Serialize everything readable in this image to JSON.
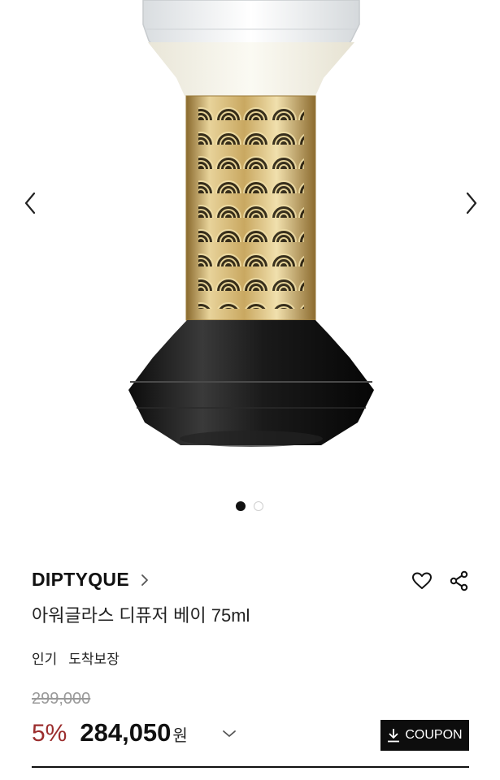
{
  "gallery": {
    "slide_count": 2,
    "active_slide": 1,
    "prev_icon": "chevron-left-icon",
    "next_icon": "chevron-right-icon"
  },
  "product": {
    "brand": "DIPTYQUE",
    "brand_icon": "chevron-right-icon",
    "name": "아워글라스 디퓨저 베이 75ml",
    "tags": [
      "인기",
      "도착보장"
    ],
    "original_price": "299,000",
    "discount": "5%",
    "price": "284,050",
    "currency": "원",
    "price_toggle_icon": "chevron-down-icon",
    "coupon_label": "COUPON",
    "coupon_icon": "download-icon",
    "wish_icon": "heart-icon",
    "share_icon": "share-icon"
  },
  "colors": {
    "discount": "#9b2d2d",
    "coupon_bg": "#0d0d0d",
    "text": "#111111"
  }
}
